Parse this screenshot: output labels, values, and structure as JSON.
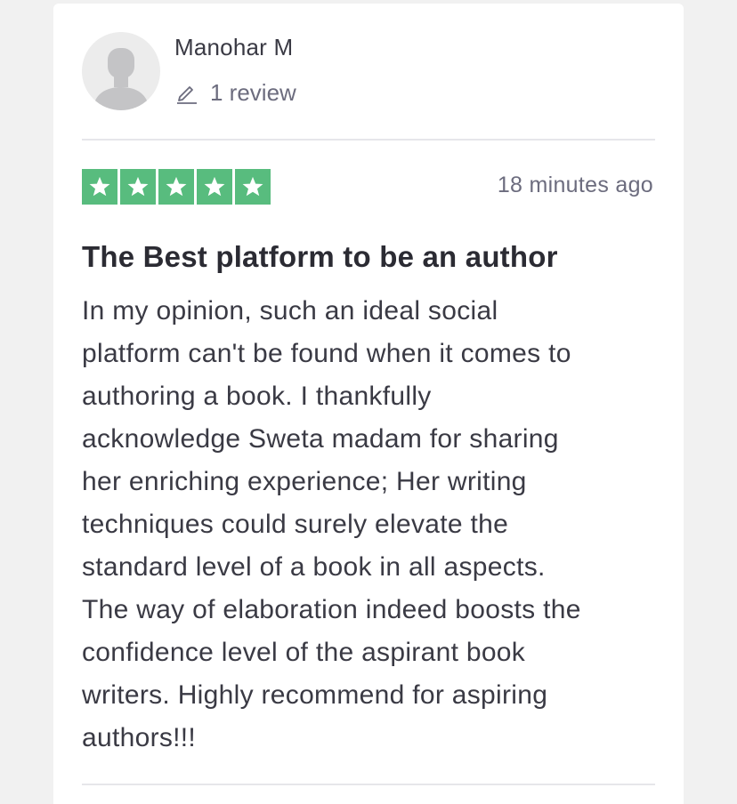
{
  "reviewer": {
    "name": "Manohar M",
    "review_count": "1 review",
    "avatar_icon": "default-user-avatar"
  },
  "rating": {
    "stars": 5,
    "max": 5,
    "color": "#58bc7e",
    "icon": "star-icon"
  },
  "review": {
    "timestamp": "18 minutes ago",
    "title": "The Best platform to be an author",
    "body_lines": [
      "In my opinion, such an ideal social",
      "platform can't be found when it comes to",
      "authoring a book. I thankfully",
      "acknowledge Sweta madam for sharing",
      "her enriching experience; Her writing",
      "techniques could surely elevate the",
      "standard level of a book in all aspects.",
      "The way of elaboration indeed boosts the",
      "confidence level of the aspirant book",
      "writers. Highly recommend for aspiring",
      "authors!!!"
    ]
  }
}
